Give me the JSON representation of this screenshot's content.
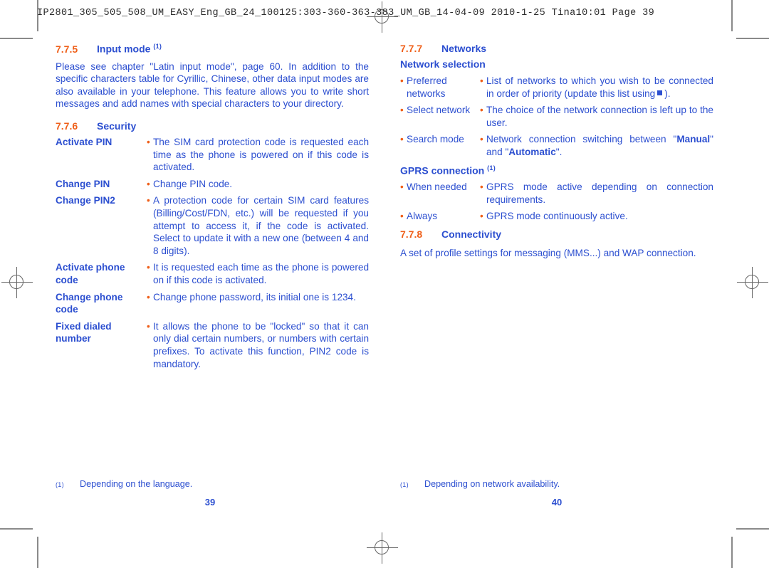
{
  "slug": {
    "text": "IP2801_305_505_508_UM_EASY_Eng_GB_24_100125:303-360-363-383_UM_GB_14-04-09   2010-1-25   Tina10:01   Page 39"
  },
  "colors": {
    "heading_number": "#ef5f19",
    "bullet": "#ef5f19",
    "body_text": "#2c4fd0",
    "slug_text": "#2b2b2b",
    "crop_mark": "#8a8a8a"
  },
  "left_column": {
    "section_input_mode": {
      "number": "7.7.5",
      "title": "Input mode",
      "footnote_mark": "(1)",
      "paragraph": "Please see chapter \"Latin input mode\", page 60. In addition to the specific characters table for Cyrillic, Chinese, other data input modes are also available in your telephone. This feature allows you to write short messages and add names with special characters to your directory."
    },
    "section_security": {
      "number": "7.7.6",
      "title": "Security",
      "rows": [
        {
          "label": "Activate PIN",
          "text": "The SIM card protection code is requested each time as the phone is powered on if this code is activated."
        },
        {
          "label": "Change PIN",
          "text": "Change PIN code."
        },
        {
          "label": "Change PIN2",
          "text": "A protection code for certain SIM card features (Billing/Cost/FDN, etc.) will be requested if you attempt to access it, if the code is activated. Select to update it with a new one (between 4 and 8 digits)."
        },
        {
          "label": "Activate phone code",
          "text": "It is requested each time as the phone is powered on if this code is activated."
        },
        {
          "label": "Change phone code",
          "text": "Change phone password, its initial one is 1234."
        },
        {
          "label": "Fixed dialed number",
          "text": "It allows the phone to be \"locked\" so that it can only dial certain numbers, or numbers with certain prefixes. To activate this function, PIN2 code is mandatory."
        }
      ]
    },
    "footnote": {
      "mark": "(1)",
      "text": "Depending on the language."
    },
    "page_number": "39"
  },
  "right_column": {
    "section_networks": {
      "number": "7.7.7",
      "title": "Networks",
      "subheading": "Network selection",
      "rows": [
        {
          "label": "Preferred networks",
          "text_before": "List of networks to which you wish to be connected in order of priority (update this list using",
          "glyph": "key-glyph",
          "text_after": ")."
        },
        {
          "label": "Select network",
          "text": "The choice of the network connection is left up to the user."
        },
        {
          "label": "Search mode",
          "text_before": "Network connection switching between \"",
          "bold1": "Manual",
          "text_middle": "\" and \"",
          "bold2": "Automatic",
          "text_after": "\"."
        }
      ]
    },
    "section_gprs": {
      "subheading": "GPRS connection",
      "footnote_mark": "(1)",
      "rows": [
        {
          "label": "When needed",
          "text": "GPRS mode active depending on connection requirements."
        },
        {
          "label": "Always",
          "text": "GPRS mode continuously active."
        }
      ]
    },
    "section_connectivity": {
      "number": "7.7.8",
      "title": "Connectivity",
      "paragraph": "A set of profile settings for messaging (MMS...) and WAP connection."
    },
    "footnote": {
      "mark": "(1)",
      "text": "Depending on network availability."
    },
    "page_number": "40"
  }
}
